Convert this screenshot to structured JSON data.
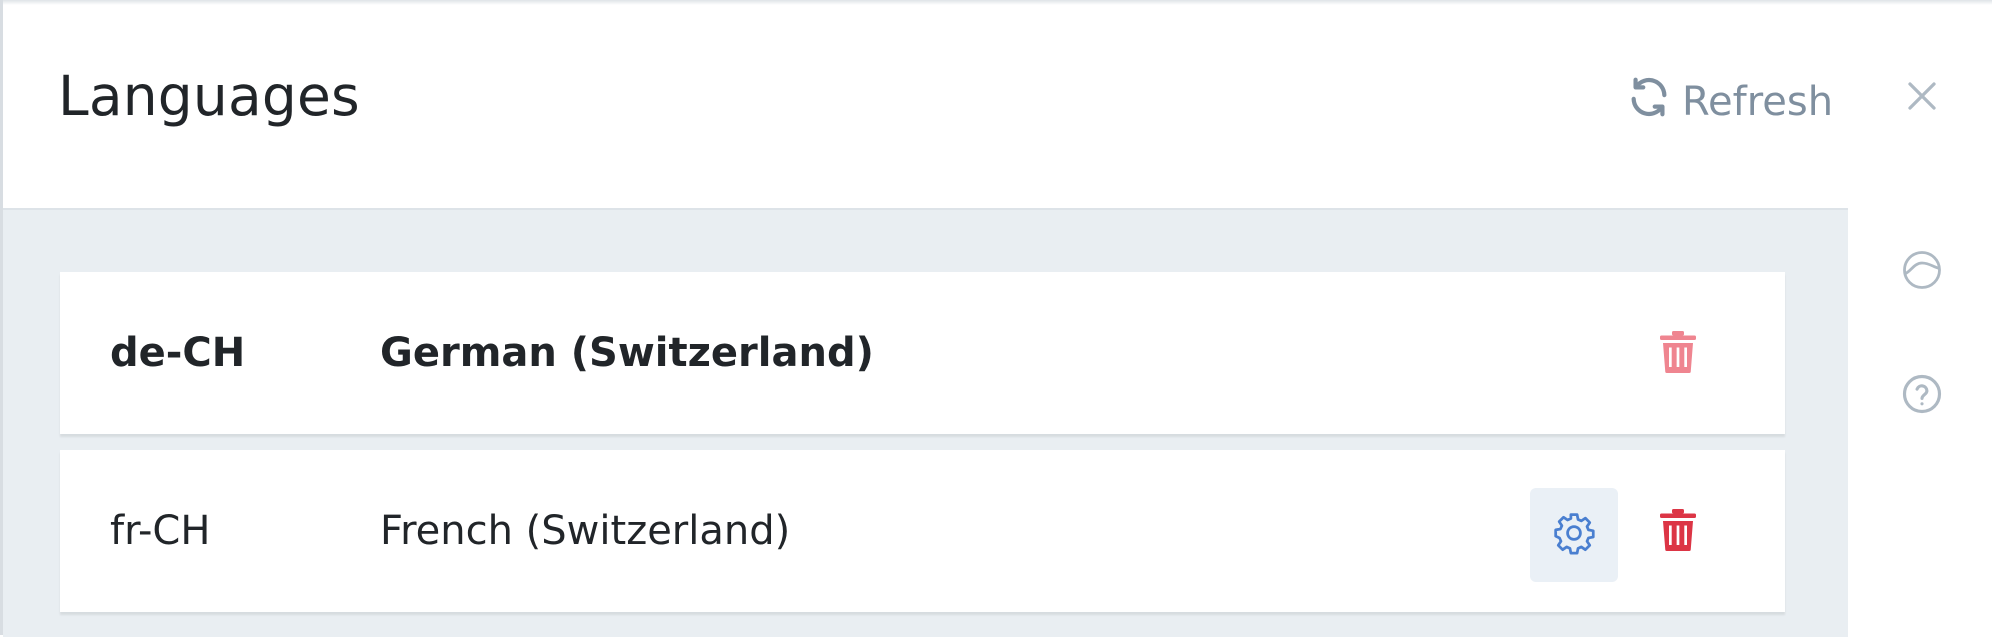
{
  "dialog": {
    "title": "Languages",
    "refresh_label": "Refresh"
  },
  "languages": [
    {
      "code": "de-CH",
      "name": "German (Switzerland)",
      "is_master": true,
      "has_settings_button": false,
      "delete_color": "#ef8590"
    },
    {
      "code": "fr-CH",
      "name": "French (Switzerland)",
      "is_master": false,
      "has_settings_button": true,
      "delete_color": "#dc3545"
    }
  ],
  "sidebar": {
    "icons": [
      "history-icon",
      "help-icon"
    ]
  },
  "colors": {
    "icon_gray": "#aeb9c3",
    "refresh_gray": "#7f8f9f",
    "settings_blue": "#4a7fd0",
    "content_bg": "#e9eef2"
  }
}
